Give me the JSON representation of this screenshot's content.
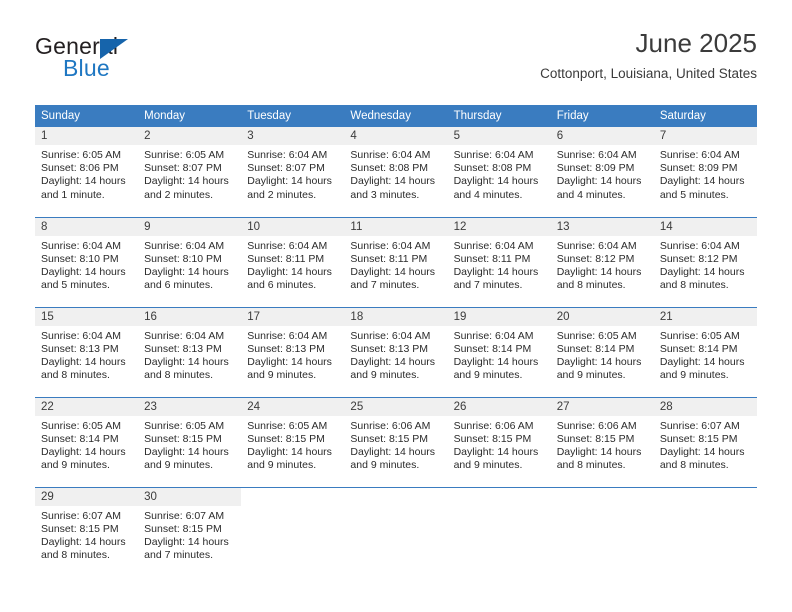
{
  "logo": {
    "primary_text": "General",
    "secondary_text": "Blue",
    "primary_color": "#231f20",
    "secondary_color": "#1f77c2",
    "triangle_color": "#1664ab",
    "icon": "triangle-icon"
  },
  "header": {
    "title": "June 2025",
    "subtitle": "Cottonport, Louisiana, United States"
  },
  "theme": {
    "header_bg": "#3a7cc0",
    "header_text": "#ffffff",
    "daynum_bg": "#f0f0f0",
    "row_border": "#3a7cc0",
    "body_text": "#2b2b2b"
  },
  "calendar": {
    "weekday_headers": [
      "Sunday",
      "Monday",
      "Tuesday",
      "Wednesday",
      "Thursday",
      "Friday",
      "Saturday"
    ],
    "weeks": [
      [
        {
          "day": "1",
          "sunrise": "Sunrise: 6:05 AM",
          "sunset": "Sunset: 8:06 PM",
          "daylight": "Daylight: 14 hours and 1 minute."
        },
        {
          "day": "2",
          "sunrise": "Sunrise: 6:05 AM",
          "sunset": "Sunset: 8:07 PM",
          "daylight": "Daylight: 14 hours and 2 minutes."
        },
        {
          "day": "3",
          "sunrise": "Sunrise: 6:04 AM",
          "sunset": "Sunset: 8:07 PM",
          "daylight": "Daylight: 14 hours and 2 minutes."
        },
        {
          "day": "4",
          "sunrise": "Sunrise: 6:04 AM",
          "sunset": "Sunset: 8:08 PM",
          "daylight": "Daylight: 14 hours and 3 minutes."
        },
        {
          "day": "5",
          "sunrise": "Sunrise: 6:04 AM",
          "sunset": "Sunset: 8:08 PM",
          "daylight": "Daylight: 14 hours and 4 minutes."
        },
        {
          "day": "6",
          "sunrise": "Sunrise: 6:04 AM",
          "sunset": "Sunset: 8:09 PM",
          "daylight": "Daylight: 14 hours and 4 minutes."
        },
        {
          "day": "7",
          "sunrise": "Sunrise: 6:04 AM",
          "sunset": "Sunset: 8:09 PM",
          "daylight": "Daylight: 14 hours and 5 minutes."
        }
      ],
      [
        {
          "day": "8",
          "sunrise": "Sunrise: 6:04 AM",
          "sunset": "Sunset: 8:10 PM",
          "daylight": "Daylight: 14 hours and 5 minutes."
        },
        {
          "day": "9",
          "sunrise": "Sunrise: 6:04 AM",
          "sunset": "Sunset: 8:10 PM",
          "daylight": "Daylight: 14 hours and 6 minutes."
        },
        {
          "day": "10",
          "sunrise": "Sunrise: 6:04 AM",
          "sunset": "Sunset: 8:11 PM",
          "daylight": "Daylight: 14 hours and 6 minutes."
        },
        {
          "day": "11",
          "sunrise": "Sunrise: 6:04 AM",
          "sunset": "Sunset: 8:11 PM",
          "daylight": "Daylight: 14 hours and 7 minutes."
        },
        {
          "day": "12",
          "sunrise": "Sunrise: 6:04 AM",
          "sunset": "Sunset: 8:11 PM",
          "daylight": "Daylight: 14 hours and 7 minutes."
        },
        {
          "day": "13",
          "sunrise": "Sunrise: 6:04 AM",
          "sunset": "Sunset: 8:12 PM",
          "daylight": "Daylight: 14 hours and 8 minutes."
        },
        {
          "day": "14",
          "sunrise": "Sunrise: 6:04 AM",
          "sunset": "Sunset: 8:12 PM",
          "daylight": "Daylight: 14 hours and 8 minutes."
        }
      ],
      [
        {
          "day": "15",
          "sunrise": "Sunrise: 6:04 AM",
          "sunset": "Sunset: 8:13 PM",
          "daylight": "Daylight: 14 hours and 8 minutes."
        },
        {
          "day": "16",
          "sunrise": "Sunrise: 6:04 AM",
          "sunset": "Sunset: 8:13 PM",
          "daylight": "Daylight: 14 hours and 8 minutes."
        },
        {
          "day": "17",
          "sunrise": "Sunrise: 6:04 AM",
          "sunset": "Sunset: 8:13 PM",
          "daylight": "Daylight: 14 hours and 9 minutes."
        },
        {
          "day": "18",
          "sunrise": "Sunrise: 6:04 AM",
          "sunset": "Sunset: 8:13 PM",
          "daylight": "Daylight: 14 hours and 9 minutes."
        },
        {
          "day": "19",
          "sunrise": "Sunrise: 6:04 AM",
          "sunset": "Sunset: 8:14 PM",
          "daylight": "Daylight: 14 hours and 9 minutes."
        },
        {
          "day": "20",
          "sunrise": "Sunrise: 6:05 AM",
          "sunset": "Sunset: 8:14 PM",
          "daylight": "Daylight: 14 hours and 9 minutes."
        },
        {
          "day": "21",
          "sunrise": "Sunrise: 6:05 AM",
          "sunset": "Sunset: 8:14 PM",
          "daylight": "Daylight: 14 hours and 9 minutes."
        }
      ],
      [
        {
          "day": "22",
          "sunrise": "Sunrise: 6:05 AM",
          "sunset": "Sunset: 8:14 PM",
          "daylight": "Daylight: 14 hours and 9 minutes."
        },
        {
          "day": "23",
          "sunrise": "Sunrise: 6:05 AM",
          "sunset": "Sunset: 8:15 PM",
          "daylight": "Daylight: 14 hours and 9 minutes."
        },
        {
          "day": "24",
          "sunrise": "Sunrise: 6:05 AM",
          "sunset": "Sunset: 8:15 PM",
          "daylight": "Daylight: 14 hours and 9 minutes."
        },
        {
          "day": "25",
          "sunrise": "Sunrise: 6:06 AM",
          "sunset": "Sunset: 8:15 PM",
          "daylight": "Daylight: 14 hours and 9 minutes."
        },
        {
          "day": "26",
          "sunrise": "Sunrise: 6:06 AM",
          "sunset": "Sunset: 8:15 PM",
          "daylight": "Daylight: 14 hours and 9 minutes."
        },
        {
          "day": "27",
          "sunrise": "Sunrise: 6:06 AM",
          "sunset": "Sunset: 8:15 PM",
          "daylight": "Daylight: 14 hours and 8 minutes."
        },
        {
          "day": "28",
          "sunrise": "Sunrise: 6:07 AM",
          "sunset": "Sunset: 8:15 PM",
          "daylight": "Daylight: 14 hours and 8 minutes."
        }
      ],
      [
        {
          "day": "29",
          "sunrise": "Sunrise: 6:07 AM",
          "sunset": "Sunset: 8:15 PM",
          "daylight": "Daylight: 14 hours and 8 minutes."
        },
        {
          "day": "30",
          "sunrise": "Sunrise: 6:07 AM",
          "sunset": "Sunset: 8:15 PM",
          "daylight": "Daylight: 14 hours and 7 minutes."
        },
        {
          "day": "",
          "sunrise": "",
          "sunset": "",
          "daylight": ""
        },
        {
          "day": "",
          "sunrise": "",
          "sunset": "",
          "daylight": ""
        },
        {
          "day": "",
          "sunrise": "",
          "sunset": "",
          "daylight": ""
        },
        {
          "day": "",
          "sunrise": "",
          "sunset": "",
          "daylight": ""
        },
        {
          "day": "",
          "sunrise": "",
          "sunset": "",
          "daylight": ""
        }
      ]
    ]
  }
}
